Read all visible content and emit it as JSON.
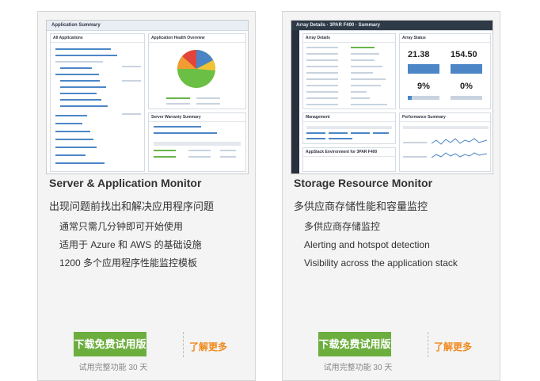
{
  "cards": [
    {
      "thumb": {
        "header": "Application Summary",
        "panel_a": "All Applications",
        "panel_b": "Application Health Overview",
        "panel_c": "Server Warranty Summary"
      },
      "title": "Server & Application Monitor",
      "subtitle": "出现问题前找出和解决应用程序问题",
      "features": [
        "通常只需几分钟即可开始使用",
        "适用于 Azure 和 AWS 的基础设施",
        "1200 多个应用程序性能监控模板"
      ],
      "cta_label": "下载免费试用版",
      "learn_more_label": "了解更多",
      "trial_note": "试用完整功能 30 天",
      "cta_color": "#6cae3e",
      "link_color": "#f08a1c"
    },
    {
      "thumb": {
        "header": "Array Details · 3PAR F400 · Summary",
        "panel_a": "Array Details",
        "panel_b": "Array Status",
        "panel_c": "Management",
        "panel_d": "Performance Summary",
        "panel_e": "AppStack Environment for 3PAR F400",
        "stat_1": "21.38",
        "stat_2": "154.50",
        "stat_3": "9%",
        "stat_4": "0%"
      },
      "title": "Storage Resource Monitor",
      "subtitle": "多供应商存储性能和容量监控",
      "features": [
        "多供应商存储监控",
        "Alerting and hotspot detection",
        "Visibility across the application stack"
      ],
      "cta_label": "下载免费试用版",
      "learn_more_label": "了解更多",
      "trial_note": "试用完整功能 30 天",
      "cta_color": "#6cae3e",
      "link_color": "#f08a1c"
    }
  ]
}
